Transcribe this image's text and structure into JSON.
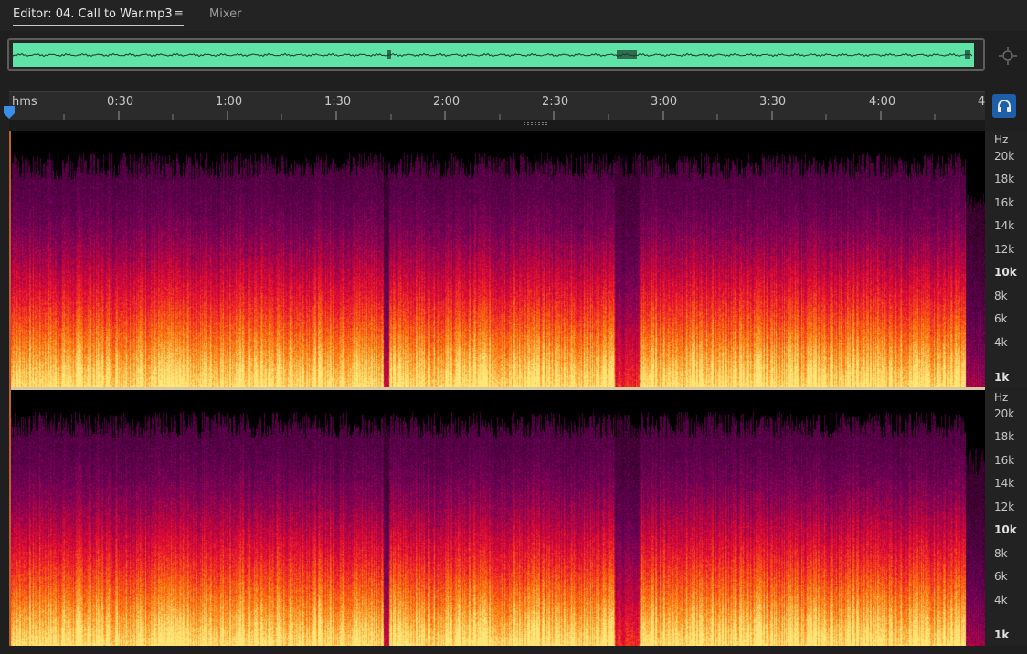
{
  "tabs": {
    "editor_label": "Editor: 04. Call to War.mp3",
    "menu_glyph": "≡",
    "mixer_label": "Mixer"
  },
  "overview": {
    "waveform_color": "#5fe3a6"
  },
  "ruler": {
    "unit_label": "hms",
    "labels": [
      "0:30",
      "1:00",
      "1:30",
      "2:00",
      "2:30",
      "3:00",
      "3:30",
      "4:00",
      "4"
    ]
  },
  "freq_axis": {
    "unit": "Hz",
    "labels": [
      "20k",
      "18k",
      "16k",
      "14k",
      "12k",
      "10k",
      "8k",
      "6k",
      "4k",
      "1k"
    ],
    "bold_labels": [
      "10k",
      "1k"
    ]
  },
  "icons": {
    "zoom": "zoom-fit-icon",
    "headphones": "headphones-icon",
    "playhead": "playhead-marker-icon"
  },
  "colors": {
    "accent": "#1f5ea8",
    "waveform": "#5fe3a6",
    "playhead": "#3b8ee8"
  }
}
